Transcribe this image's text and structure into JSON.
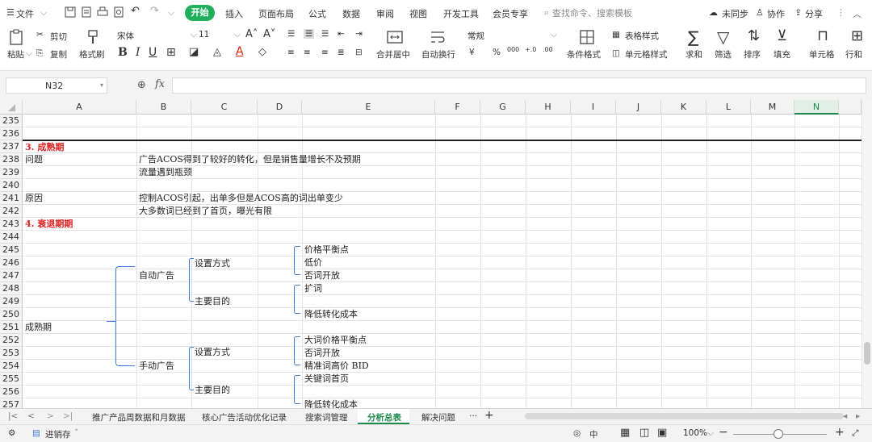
{
  "menubar": {
    "file_label": "文件",
    "tabs": [
      "开始",
      "插入",
      "页面布局",
      "公式",
      "数据",
      "审阅",
      "视图",
      "开发工具",
      "会员专享"
    ],
    "search_placeholder": "查找命令、搜索模板",
    "sync_label": "未同步",
    "collab_label": "协作",
    "share_label": "分享"
  },
  "toolbar": {
    "paste_label": "粘贴",
    "cut_label": "剪切",
    "copy_label": "复制",
    "format_painter_label": "格式刷",
    "font_name": "宋体",
    "font_size": "11",
    "merge_label": "合并居中",
    "wrap_label": "自动换行",
    "number_format": "常规",
    "cond_format_label": "条件格式",
    "table_style_label": "表格样式",
    "cell_style_label": "单元格样式",
    "sum_label": "求和",
    "filter_label": "筛选",
    "sort_label": "排序",
    "fill_label": "填充",
    "cell_label": "单元格",
    "rowcol_label": "行和"
  },
  "formula_bar": {
    "name_box": "N32",
    "fx": "fx",
    "value": ""
  },
  "columns": [
    "A",
    "B",
    "C",
    "D",
    "E",
    "F",
    "G",
    "H",
    "I",
    "J",
    "K",
    "L",
    "M",
    "N"
  ],
  "selected_column": "N",
  "rows": [
    "235",
    "236",
    "237",
    "238",
    "239",
    "240",
    "241",
    "242",
    "243",
    "244",
    "245",
    "246",
    "247",
    "248",
    "249",
    "250",
    "251",
    "252",
    "253",
    "254",
    "255",
    "256",
    "257"
  ],
  "cells": {
    "r237_a": "3. 成熟期",
    "r238_a": "问题",
    "r238_b": "广告ACOS得到了较好的转化，但是销售量增长不及预期",
    "r239_b": "流量遇到瓶颈",
    "r241_a": "原因",
    "r241_b": "控制ACOS引起，出单多但是ACOS高的词出单变少",
    "r242_b": "大多数词已经到了首页，曝光有限",
    "r243_a": "4. 衰退期期",
    "r251_a": "成熟期",
    "r247_b": "自动广告",
    "r254_b": "手动广告",
    "r246_c": "设置方式",
    "r249_c": "主要目的",
    "r253_c": "设置方式",
    "r256_c": "主要目的",
    "r245_e": "价格平衡点",
    "r246_e": "低价",
    "r247_e": "否词开放",
    "r248_e": "扩词",
    "r250_e": "降低转化成本",
    "r252_e": "大词价格平衡点",
    "r253_e": "否词开放",
    "r254_e": "精准词高价 BID",
    "r255_e": "关键词首页",
    "r257_e": "降低转化成本"
  },
  "sheet_tabs": [
    "推广产品周数据和月数据",
    "核心广告活动优化记录",
    "搜索词管理",
    "分析总表",
    "解决问题"
  ],
  "active_sheet": "分析总表",
  "statusbar": {
    "mode_label": "进销存",
    "zoom": "100%"
  },
  "colors": {
    "accent": "#1fae5b",
    "red_heading": "#e02020",
    "bracket": "#3b7dd8"
  }
}
